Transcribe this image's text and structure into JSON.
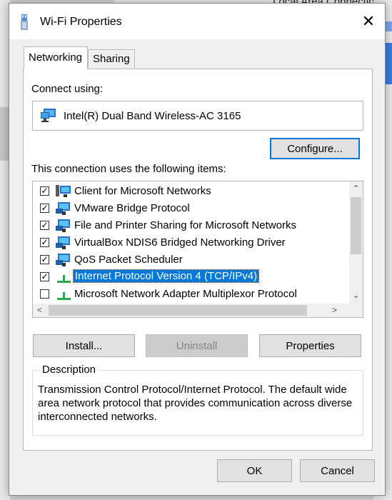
{
  "background": {
    "top_title": "Local Area Connection"
  },
  "window": {
    "title": "Wi-Fi Properties",
    "close_glyph": "✕"
  },
  "tabs": [
    {
      "label": "Networking",
      "active": true
    },
    {
      "label": "Sharing",
      "active": false
    }
  ],
  "connect_using": {
    "label": "Connect using:",
    "adapter": "Intel(R) Dual Band Wireless-AC 3165",
    "adapter_icon": "network-adapter-icon"
  },
  "buttons": {
    "configure": "Configure...",
    "install": "Install...",
    "uninstall": "Uninstall",
    "properties": "Properties",
    "ok": "OK",
    "cancel": "Cancel"
  },
  "items_label": "This connection uses the following items:",
  "items": [
    {
      "label": "Client for Microsoft Networks",
      "checked": true,
      "icon": "network-client-icon",
      "selected": false
    },
    {
      "label": "VMware Bridge Protocol",
      "checked": true,
      "icon": "network-service-icon",
      "selected": false
    },
    {
      "label": "File and Printer Sharing for Microsoft Networks",
      "checked": true,
      "icon": "network-service-icon",
      "selected": false
    },
    {
      "label": "VirtualBox NDIS6 Bridged Networking Driver",
      "checked": true,
      "icon": "network-service-icon",
      "selected": false
    },
    {
      "label": "QoS Packet Scheduler",
      "checked": true,
      "icon": "network-service-icon",
      "selected": false
    },
    {
      "label": "Internet Protocol Version 4 (TCP/IPv4)",
      "checked": true,
      "icon": "protocol-icon",
      "selected": true
    },
    {
      "label": "Microsoft Network Adapter Multiplexor Protocol",
      "checked": false,
      "icon": "protocol-icon",
      "selected": false
    }
  ],
  "description": {
    "legend": "Description",
    "text": "Transmission Control Protocol/Internet Protocol. The default wide area network protocol that provides communication across diverse interconnected networks."
  },
  "colors": {
    "accent": "#0078d7",
    "dialog_bg": "#f0f0f0"
  }
}
